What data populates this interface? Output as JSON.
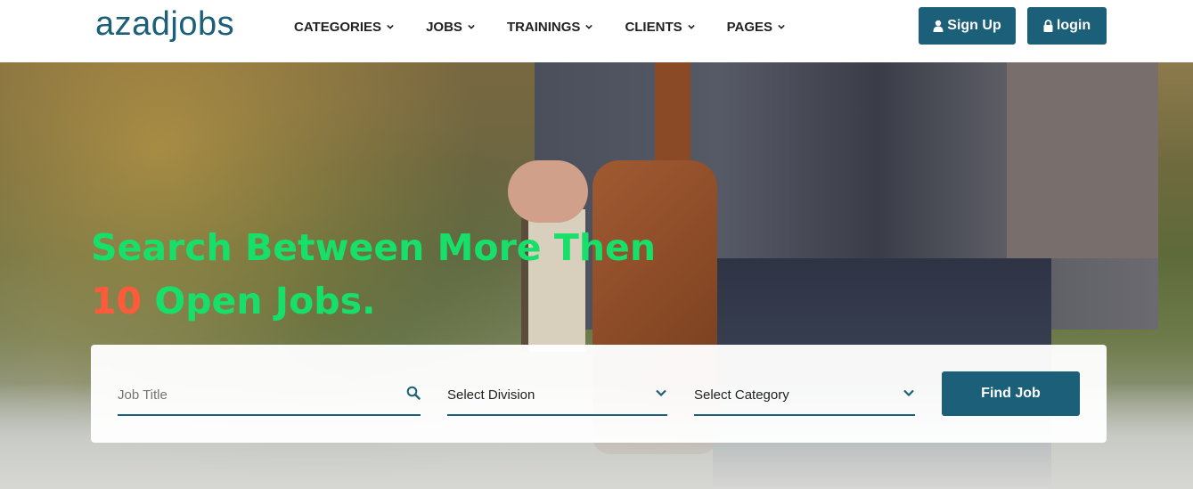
{
  "brand": {
    "logo_text": "azadjobs",
    "color": "#1c5f79"
  },
  "nav": {
    "items": [
      {
        "label": "CATEGORIES"
      },
      {
        "label": "JOBS"
      },
      {
        "label": "TRAININGS"
      },
      {
        "label": "CLIENTS"
      },
      {
        "label": "PAGES"
      }
    ]
  },
  "header_buttons": {
    "signup_label": "Sign Up",
    "login_label": "login"
  },
  "hero": {
    "headline_line1": "Search Between More Then",
    "headline_count": "10",
    "headline_line2_rest": " Open Jobs.",
    "headline_color": "#16e06a",
    "count_color": "#ff5a3a"
  },
  "search": {
    "job_title_placeholder": "Job Title",
    "division_value": "Select Division",
    "category_value": "Select Category",
    "submit_label": "Find Job"
  }
}
